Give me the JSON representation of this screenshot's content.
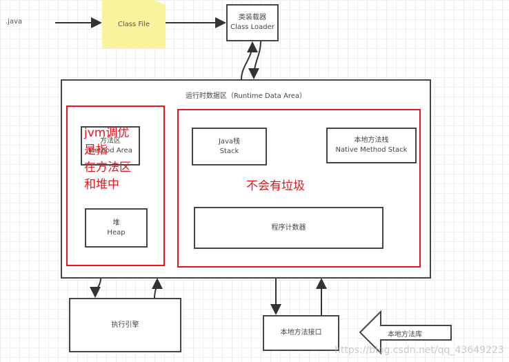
{
  "source_label": ".java",
  "class_file": "Class File",
  "class_loader": {
    "cn": "类装载器",
    "en": "Class Loader"
  },
  "runtime_area": {
    "title": "运行时数据区（Runtime Data Area）",
    "method_area": {
      "cn": "方法区",
      "en": "Method Area"
    },
    "heap": {
      "cn": "堆",
      "en": "Heap"
    },
    "java_stack": {
      "cn": "Java栈",
      "en": "Stack"
    },
    "native_stack": {
      "cn": "本地方法栈",
      "en": "Native Method Stack"
    },
    "pc_register": "程序计数器"
  },
  "annotations": {
    "tuning": [
      "jvm调优",
      "是指",
      "在方法区",
      "和堆中"
    ],
    "no_garbage": "不会有垃圾"
  },
  "execution_engine": "执行引擎",
  "native_interface": "本地方法接口",
  "native_library": "本地方法库",
  "watermark": "https://blog.csdn.net/qq_43649223",
  "colors": {
    "annotation": "#e8141c",
    "note": "#faf39e"
  }
}
